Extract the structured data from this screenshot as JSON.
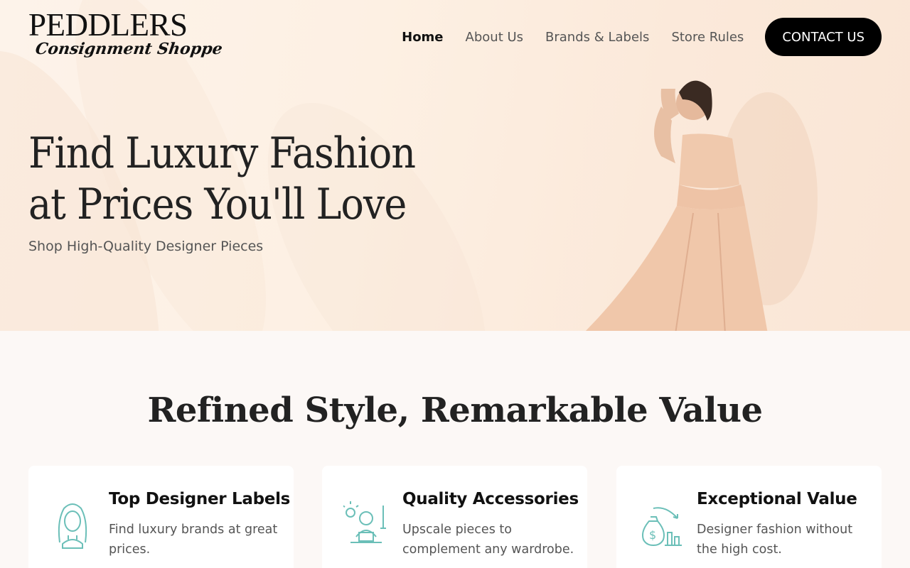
{
  "brand": {
    "name": "PEDDLERS",
    "tagline": "Consignment Shoppe"
  },
  "nav": {
    "items": [
      {
        "label": "Home",
        "active": true
      },
      {
        "label": "About Us"
      },
      {
        "label": "Brands & Labels"
      },
      {
        "label": "Store Rules"
      }
    ],
    "cta": "CONTACT US"
  },
  "hero": {
    "title_line1": "Find Luxury Fashion",
    "title_line2": "at Prices You'll Love",
    "subtitle": "Shop High-Quality Designer Pieces"
  },
  "features": {
    "title": "Refined Style, Remarkable Value",
    "cards": [
      {
        "title": "Top Designer Labels",
        "text": "Find luxury brands at great prices.",
        "icon": "woman-icon"
      },
      {
        "title": "Quality Accessories",
        "text": "Upscale pieces to complement any wardrobe.",
        "icon": "designer-icon"
      },
      {
        "title": "Exceptional Value",
        "text": "Designer fashion without the high cost.",
        "icon": "money-bag-icon"
      }
    ]
  },
  "colors": {
    "accent": "#6bbfb8",
    "cta_bg": "#000000",
    "hero_bg": "#fdf0e3"
  }
}
